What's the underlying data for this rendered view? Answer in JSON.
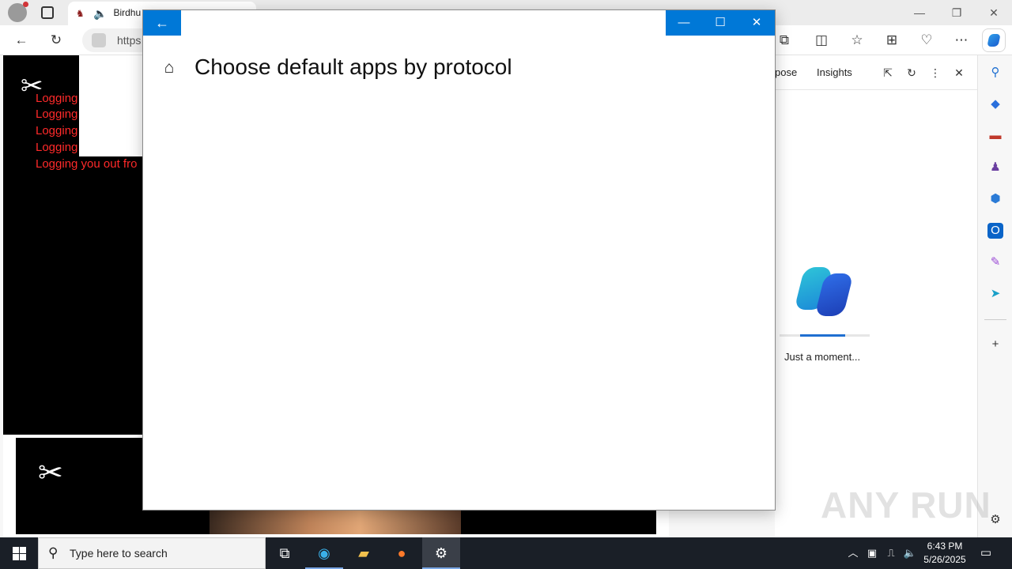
{
  "browser": {
    "tabs": [
      {
        "label": "Birdhu",
        "state": "active"
      },
      {
        "label": "",
        "state": "inactive"
      }
    ],
    "address": {
      "value": "https"
    },
    "window_controls": [
      "—",
      "❐",
      "✕"
    ]
  },
  "page": {
    "log_lines": [
      "Logging",
      "Logging",
      "Logging",
      "Logging",
      "Logging you out fro"
    ]
  },
  "copilot_panel": {
    "tabs": {
      "compose": "pose",
      "insights": "Insights"
    },
    "status_text": "Just a moment...",
    "progress_fraction": 0.5
  },
  "settings_window": {
    "title": "Choose default apps by protocol",
    "accent_color": "#0078d7"
  },
  "watermark": {
    "text": "ANY RUN"
  },
  "taskbar": {
    "search_placeholder": "Type here to search",
    "time": "6:43 PM",
    "date": "5/26/2025"
  }
}
